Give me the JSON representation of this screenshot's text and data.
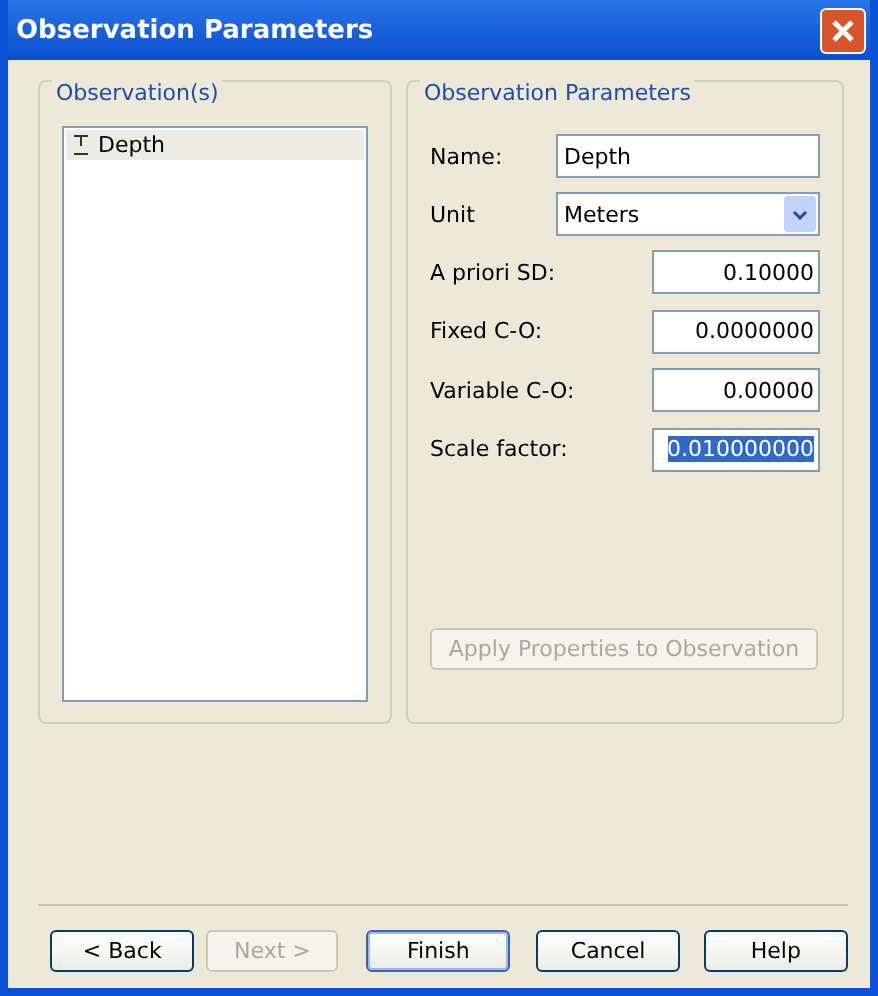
{
  "window": {
    "title": "Observation Parameters"
  },
  "observations": {
    "title": "Observation(s)",
    "items": [
      {
        "label": "Depth",
        "selected": true
      }
    ]
  },
  "parameters": {
    "title": "Observation Parameters",
    "fields": [
      {
        "kind": "text",
        "label": "Name:",
        "value": "Depth",
        "highlighted": false
      },
      {
        "kind": "select",
        "label": "Unit",
        "value": "Meters",
        "highlighted": false
      },
      {
        "kind": "number",
        "label": "A priori SD:",
        "value": "0.10000",
        "highlighted": false
      },
      {
        "kind": "number",
        "label": "Fixed C-O:",
        "value": "0.0000000",
        "highlighted": false
      },
      {
        "kind": "number",
        "label": "Variable C-O:",
        "value": "0.00000",
        "highlighted": false
      },
      {
        "kind": "number",
        "label": "Scale factor:",
        "value": "0.010000000",
        "highlighted": true
      }
    ],
    "apply": {
      "label": "Apply Properties to Observation",
      "disabled": true
    }
  },
  "buttons": [
    {
      "label": "< Back",
      "disabled": false,
      "default": false
    },
    {
      "label": "Next >",
      "disabled": true,
      "default": false
    },
    {
      "label": "Finish",
      "disabled": false,
      "default": true
    },
    {
      "label": "Cancel",
      "disabled": false,
      "default": false
    },
    {
      "label": "Help",
      "disabled": false,
      "default": false
    }
  ]
}
